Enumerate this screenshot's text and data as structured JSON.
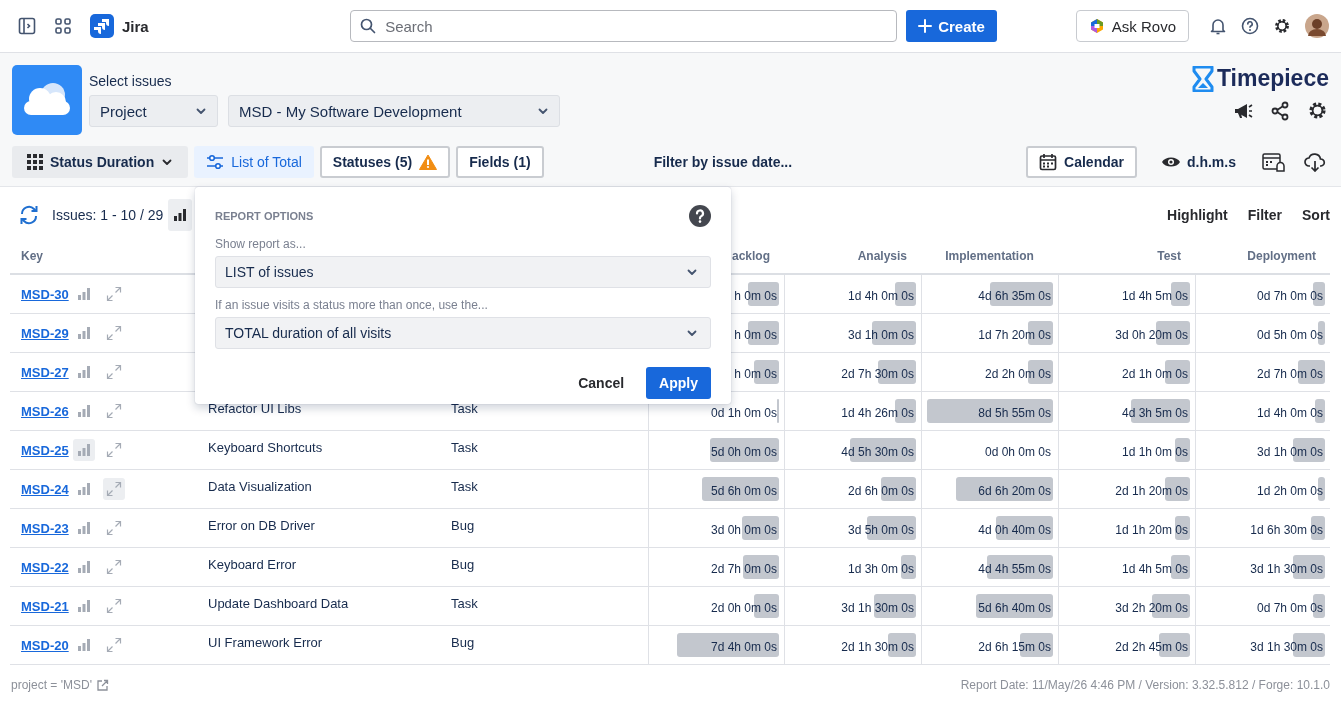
{
  "topbar": {
    "product": "Jira",
    "search": {
      "placeholder": "Search"
    },
    "create_label": "Create",
    "rovo_label": "Ask Rovo"
  },
  "app": {
    "select_label": "Select issues",
    "scope": {
      "value": "Project"
    },
    "project": {
      "value": "MSD - My Software Development"
    },
    "brand": "Timepiece"
  },
  "toolbar": {
    "items": [
      {
        "kind": "dropdown",
        "label": "Status Duration",
        "selected": false
      },
      {
        "kind": "options",
        "label": "List of Total",
        "selected": true
      },
      {
        "kind": "warning",
        "label": "Statuses (5)",
        "selected": false
      },
      {
        "kind": "plain",
        "label": "Fields (1)",
        "selected": false
      }
    ],
    "filter_label": "Filter by issue date...",
    "calendar_label": "Calendar",
    "format_label": "d.h.m.s"
  },
  "summary_bar": {
    "issues_label": "Issues: 1 - 10 / 29",
    "actions": [
      "Highlight",
      "Filter",
      "Sort"
    ]
  },
  "table": {
    "key_column": "Key",
    "status_columns": [
      "acklog",
      "Analysis",
      "Implementation",
      "Test",
      "Deployment"
    ],
    "rows": [
      {
        "key": "MSD-30",
        "chart_highlighted": false,
        "expand_highlighted": false,
        "durations": [
          {
            "value": "h 0m 0s",
            "level": 0.25
          },
          {
            "value": "1d 4h 0m 0s",
            "level": 0.17
          },
          {
            "value": "4d 6h 35m 0s",
            "level": 0.5
          },
          {
            "value": "1d 4h 5m 0s",
            "level": 0.15
          },
          {
            "value": "0d 7h 0m 0s",
            "level": 0.1
          }
        ]
      },
      {
        "key": "MSD-29",
        "chart_highlighted": false,
        "expand_highlighted": false,
        "durations": [
          {
            "value": "h 0m 0s",
            "level": 0.25
          },
          {
            "value": "3d 1h 0m 0s",
            "level": 0.35
          },
          {
            "value": "1d 7h 20m 0s",
            "level": 0.2
          },
          {
            "value": "3d 0h 20m 0s",
            "level": 0.27
          },
          {
            "value": "0d 5h 0m 0s",
            "level": 0.06
          }
        ]
      },
      {
        "key": "MSD-27",
        "chart_highlighted": false,
        "expand_highlighted": false,
        "durations": [
          {
            "value": "h 0m 0s",
            "level": 0.2
          },
          {
            "value": "2d 7h 30m 0s",
            "level": 0.3
          },
          {
            "value": "2d 2h 0m 0s",
            "level": 0.2
          },
          {
            "value": "2d 1h 0m 0s",
            "level": 0.2
          },
          {
            "value": "2d 7h 0m 0s",
            "level": 0.22
          }
        ]
      },
      {
        "key": "MSD-26",
        "summary": "Refactor UI Libs",
        "type": "Task",
        "chart_highlighted": false,
        "expand_highlighted": false,
        "durations": [
          {
            "value": "0d 1h 0m 0s",
            "level": 0.02
          },
          {
            "value": "1d 4h 26m 0s",
            "level": 0.17
          },
          {
            "value": "8d 5h 55m 0s",
            "level": 1
          },
          {
            "value": "4d 3h 5m 0s",
            "level": 0.47
          },
          {
            "value": "1d 4h 0m 0s",
            "level": 0.08
          }
        ]
      },
      {
        "key": "MSD-25",
        "summary": "Keyboard Shortcuts",
        "type": "Task",
        "chart_highlighted": true,
        "expand_highlighted": false,
        "durations": [
          {
            "value": "5d 0h 0m 0s",
            "level": 0.55
          },
          {
            "value": "4d 5h 30m 0s",
            "level": 0.52
          },
          {
            "value": "0d 0h 0m 0s",
            "level": 0
          },
          {
            "value": "1d 1h 0m 0s",
            "level": 0.12
          },
          {
            "value": "3d 1h 0m 0s",
            "level": 0.26
          }
        ]
      },
      {
        "key": "MSD-24",
        "summary": "Data Visualization",
        "type": "Task",
        "chart_highlighted": false,
        "expand_highlighted": true,
        "durations": [
          {
            "value": "5d 6h 0m 0s",
            "level": 0.62
          },
          {
            "value": "2d 6h 0m 0s",
            "level": 0.28
          },
          {
            "value": "6d 6h 20m 0s",
            "level": 0.77
          },
          {
            "value": "2d 1h 20m 0s",
            "level": 0.2
          },
          {
            "value": "1d 2h 0m 0s",
            "level": 0.06
          }
        ]
      },
      {
        "key": "MSD-23",
        "summary": "Error on DB Driver",
        "type": "Bug",
        "chart_highlighted": false,
        "expand_highlighted": false,
        "durations": [
          {
            "value": "3d 0h 0m 0s",
            "level": 0.3
          },
          {
            "value": "3d 5h 0m 0s",
            "level": 0.39
          },
          {
            "value": "4d 0h 40m 0s",
            "level": 0.45
          },
          {
            "value": "1d 1h 20m 0s",
            "level": 0.12
          },
          {
            "value": "1d 6h 30m 0s",
            "level": 0.11
          }
        ]
      },
      {
        "key": "MSD-22",
        "summary": "Keyboard Error",
        "type": "Bug",
        "chart_highlighted": false,
        "expand_highlighted": false,
        "durations": [
          {
            "value": "2d 7h 0m 0s",
            "level": 0.29
          },
          {
            "value": "1d 3h 0m 0s",
            "level": 0.12
          },
          {
            "value": "4d 4h 55m 0s",
            "level": 0.52
          },
          {
            "value": "1d 4h 5m 0s",
            "level": 0.15
          },
          {
            "value": "3d 1h 30m 0s",
            "level": 0.26
          }
        ]
      },
      {
        "key": "MSD-21",
        "summary": "Update Dashboard Data",
        "type": "Task",
        "chart_highlighted": false,
        "expand_highlighted": false,
        "durations": [
          {
            "value": "2d 0h 0m 0s",
            "level": 0.2
          },
          {
            "value": "3d 1h 30m 0s",
            "level": 0.33
          },
          {
            "value": "5d 6h 40m 0s",
            "level": 0.61
          },
          {
            "value": "3d 2h 20m 0s",
            "level": 0.3
          },
          {
            "value": "0d 7h 0m 0s",
            "level": 0.1
          }
        ]
      },
      {
        "key": "MSD-20",
        "summary": "UI Framework Error",
        "type": "Bug",
        "chart_highlighted": false,
        "expand_highlighted": false,
        "durations": [
          {
            "value": "7d 4h 0m 0s",
            "level": 0.82
          },
          {
            "value": "2d 1h 30m 0s",
            "level": 0.22
          },
          {
            "value": "2d 6h 15m 0s",
            "level": 0.26
          },
          {
            "value": "2d 2h 45m 0s",
            "level": 0.25
          },
          {
            "value": "3d 1h 30m 0s",
            "level": 0.26
          }
        ]
      }
    ]
  },
  "report_options": {
    "title": "REPORT OPTIONS",
    "fields": [
      {
        "label": "Show report as...",
        "value": "LIST of issues"
      },
      {
        "label": "If an issue visits a status more than once, use the...",
        "value": "TOTAL duration of all visits"
      }
    ],
    "cancel_label": "Cancel",
    "apply_label": "Apply"
  },
  "footer": {
    "query": "project = 'MSD'",
    "report_info": "Report Date: 11/May/26 4:46 PM / Version: 3.32.5.812 / Forge: 10.1.0"
  }
}
